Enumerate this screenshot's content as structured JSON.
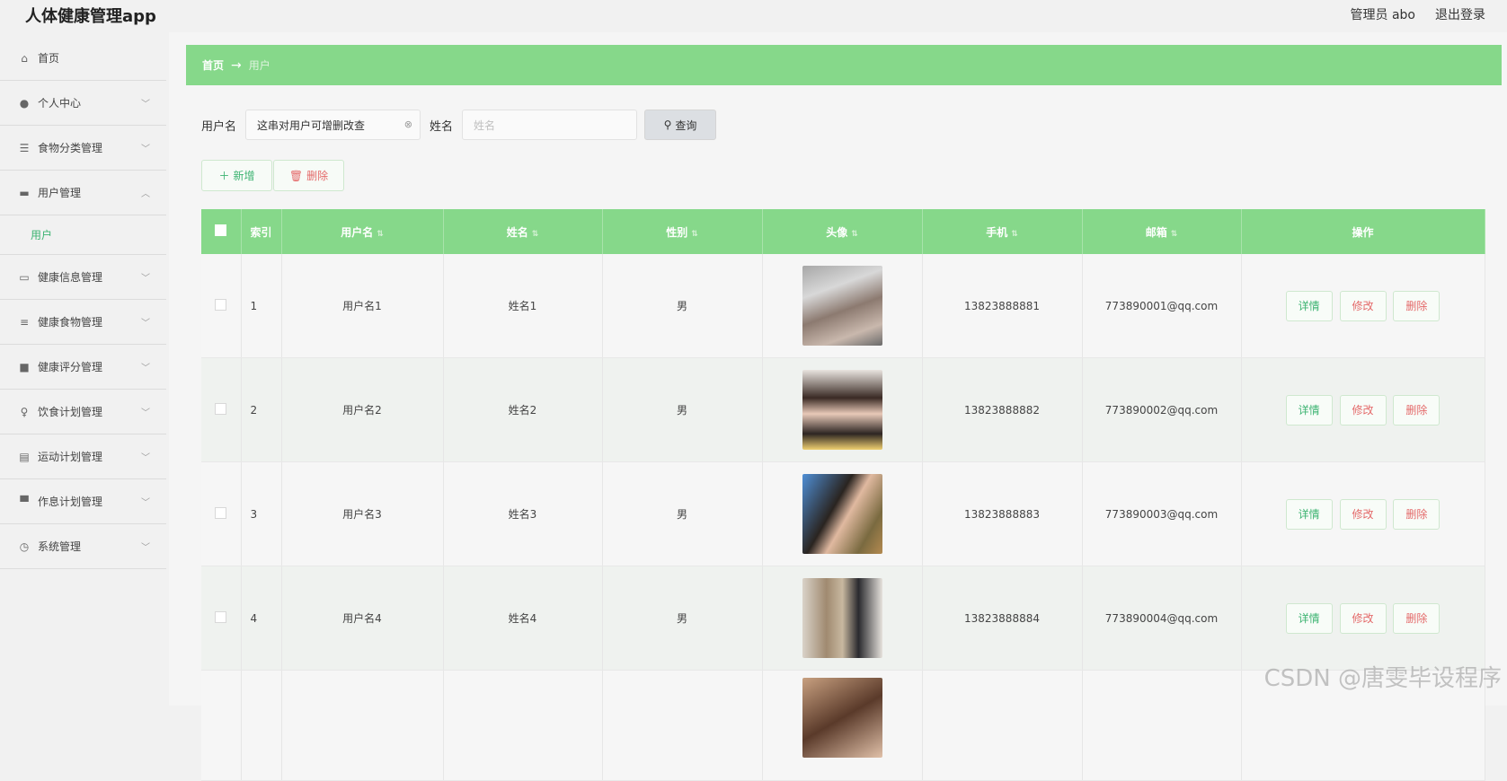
{
  "app": {
    "title": "人体健康管理app",
    "user_label": "管理员 abo",
    "logout": "退出登录"
  },
  "sidebar": {
    "items": [
      {
        "label": "首页",
        "icon": "home-icon"
      },
      {
        "label": "个人中心",
        "icon": "user-icon"
      },
      {
        "label": "食物分类管理",
        "icon": "sliders-icon"
      },
      {
        "label": "用户管理",
        "icon": "server-icon",
        "expanded": true
      },
      {
        "label": "健康信息管理",
        "icon": "card-icon"
      },
      {
        "label": "健康食物管理",
        "icon": "list-icon"
      },
      {
        "label": "健康评分管理",
        "icon": "chart-icon"
      },
      {
        "label": "饮食计划管理",
        "icon": "mic-icon"
      },
      {
        "label": "运动计划管理",
        "icon": "clipboard-icon"
      },
      {
        "label": "作息计划管理",
        "icon": "message-icon"
      },
      {
        "label": "系统管理",
        "icon": "clock-icon"
      }
    ],
    "sub_item": "用户"
  },
  "breadcrumb": {
    "home": "首页",
    "arrow": "→",
    "current": "用户"
  },
  "search": {
    "username_label": "用户名",
    "username_value": "这串对用户可增删改查",
    "name_label": "姓名",
    "name_placeholder": "姓名",
    "query_button": "查询"
  },
  "actions": {
    "add": "新增",
    "delete": "删除"
  },
  "table": {
    "headers": [
      "索引",
      "用户名",
      "姓名",
      "性别",
      "头像",
      "手机",
      "邮箱",
      "操作"
    ],
    "rows": [
      {
        "idx": "1",
        "username": "用户名1",
        "name": "姓名1",
        "gender": "男",
        "phone": "13823888881",
        "email": "773890001@qq.com"
      },
      {
        "idx": "2",
        "username": "用户名2",
        "name": "姓名2",
        "gender": "男",
        "phone": "13823888882",
        "email": "773890002@qq.com"
      },
      {
        "idx": "3",
        "username": "用户名3",
        "name": "姓名3",
        "gender": "男",
        "phone": "13823888883",
        "email": "773890003@qq.com"
      },
      {
        "idx": "4",
        "username": "用户名4",
        "name": "姓名4",
        "gender": "男",
        "phone": "13823888884",
        "email": "773890004@qq.com"
      },
      {
        "idx": "",
        "username": "",
        "name": "",
        "gender": "",
        "phone": "",
        "email": ""
      }
    ],
    "ops": {
      "detail": "详情",
      "edit": "修改",
      "del": "删除"
    }
  },
  "watermark": "CSDN @唐雯毕设程序",
  "colors": {
    "accent": "#86d88a",
    "danger": "#e46a6a",
    "link": "#3cb371"
  }
}
